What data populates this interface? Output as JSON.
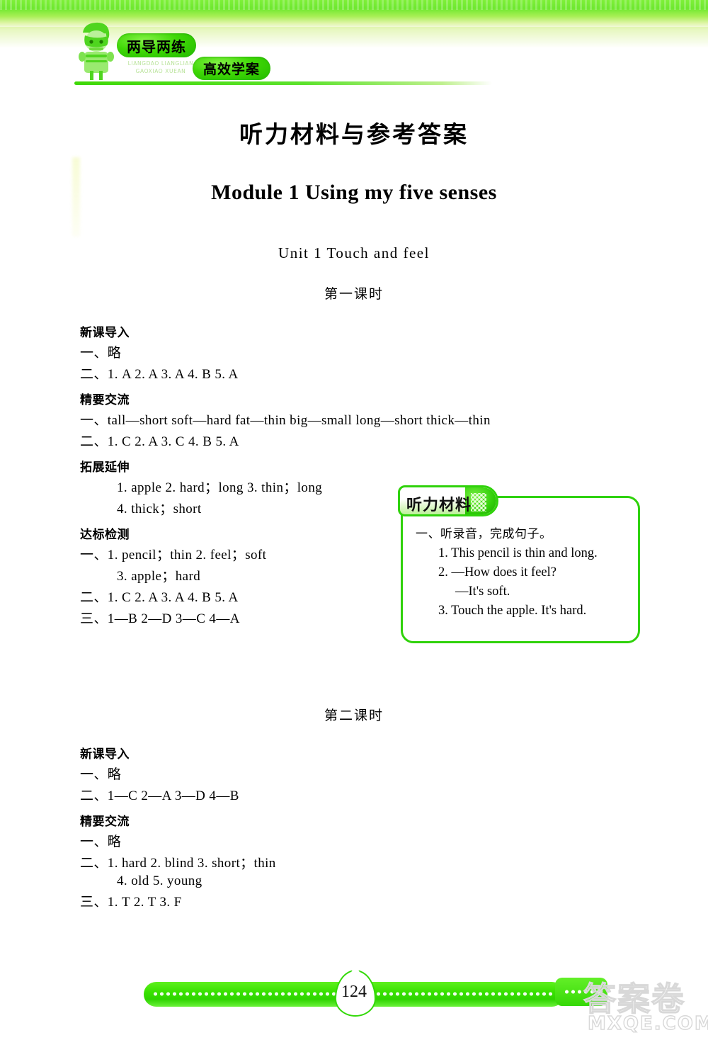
{
  "masthead": {
    "brand_primary": "两导两练",
    "brand_secondary": "高效学案",
    "pinyin": "LIANGDAO LIANGLIAN\nGAOXIAO XUEAN"
  },
  "doc_title": "听力材料与参考答案",
  "module_title": "Module 1 Using my five senses",
  "unit_title": "Unit 1 Touch and feel",
  "periods": {
    "first": "第一课时",
    "second": "第二课时"
  },
  "period1": {
    "sections": [
      {
        "heading": "新课导入",
        "lines": [
          {
            "text": "一、略",
            "indent": false
          },
          {
            "text": "二、1. A  2. A  3. A  4. B  5. A",
            "indent": false
          }
        ]
      },
      {
        "heading": "精要交流",
        "lines": [
          {
            "text": "一、tall—short  soft—hard  fat—thin  big—small  long—short  thick—thin",
            "indent": false
          },
          {
            "text": "二、1. C  2. A  3. C  4. B  5. A",
            "indent": false
          }
        ]
      },
      {
        "heading": "拓展延伸",
        "lines": [
          {
            "text": "1. apple   2. hard；long   3. thin；long",
            "indent": true
          },
          {
            "text": "4. thick；short",
            "indent": true
          }
        ]
      },
      {
        "heading": "达标检测",
        "lines": [
          {
            "text": "一、1. pencil；thin   2. feel；soft",
            "indent": false
          },
          {
            "text": "3. apple；hard",
            "indent": true
          },
          {
            "text": "二、1. C  2. A  3. A  4. B  5. A",
            "indent": false
          },
          {
            "text": "三、1—B  2—D  3—C  4—A",
            "indent": false
          }
        ]
      }
    ]
  },
  "period2": {
    "sections": [
      {
        "heading": "新课导入",
        "lines": [
          {
            "text": "一、略",
            "indent": false
          },
          {
            "text": "二、1—C  2—A  3—D  4—B",
            "indent": false
          }
        ]
      },
      {
        "heading": "精要交流",
        "lines": [
          {
            "text": "一、略",
            "indent": false
          },
          {
            "text": "二、1. hard   2. blind   3. short；thin",
            "indent": false
          },
          {
            "text": "4. old    5. young",
            "indent": true
          },
          {
            "text": "三、1. T  2. T  3. F",
            "indent": false
          }
        ]
      }
    ]
  },
  "listening_material": {
    "tab_label": "听力材料",
    "question": "一、听录音，完成句子。",
    "items": [
      {
        "text": "1. This pencil is thin and long.",
        "sub": false
      },
      {
        "text": "2. —How does it feel?",
        "sub": false
      },
      {
        "text": "—It's soft.",
        "sub": true
      },
      {
        "text": "3. Touch the apple. It's hard.",
        "sub": false
      }
    ]
  },
  "footer": {
    "page_number": "124"
  },
  "watermark": {
    "cn": "答案卷",
    "en": "MXQE.COM"
  },
  "colors": {
    "brand_green": "#2fd20a",
    "band_green": "#6ee82f",
    "bright_green": "#39e200"
  }
}
